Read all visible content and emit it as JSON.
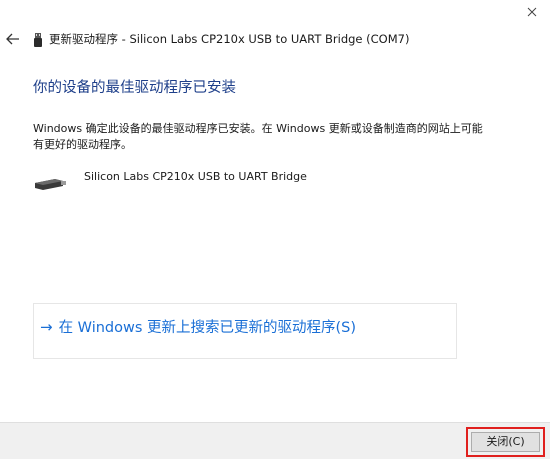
{
  "window": {
    "title": "更新驱动程序 - Silicon Labs CP210x USB to UART Bridge (COM7)",
    "close_icon": "close-icon",
    "back_icon": "back-arrow-icon"
  },
  "main": {
    "heading": "你的设备的最佳驱动程序已安装",
    "description": "Windows 确定此设备的最佳驱动程序已安装。在 Windows 更新或设备制造商的网站上可能有更好的驱动程序。",
    "device_name": "Silicon Labs CP210x USB to UART Bridge",
    "device_icon": "usb-device-icon"
  },
  "search": {
    "arrow": "→",
    "link_label": "在 Windows 更新上搜索已更新的驱动程序(S)"
  },
  "footer": {
    "close_button_label": "关闭(C)"
  },
  "colors": {
    "heading": "#1e3f8a",
    "link": "#1a6fd6",
    "highlight_border": "#e0201e",
    "footer_bg": "#f0f0f0"
  }
}
